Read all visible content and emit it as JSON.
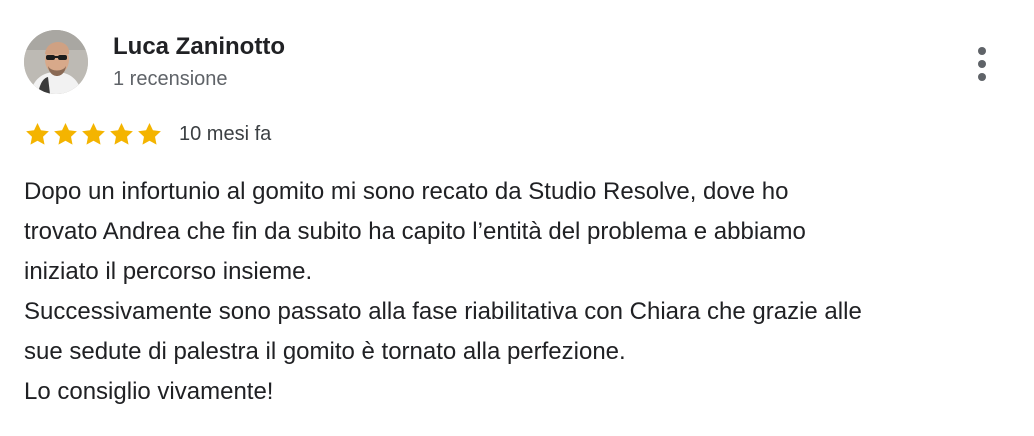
{
  "review": {
    "author": "Luca Zaninotto",
    "author_meta": "1 recensione",
    "rating": 5,
    "rating_max": 5,
    "date": "10 mesi fa",
    "text_lines": [
      "Dopo un infortunio al gomito mi sono recato da Studio Resolve, dove ho",
      "trovato Andrea che fin da subito ha capito l’entità del problema e abbiamo",
      "iniziato il percorso insieme.",
      "Successivamente sono passato alla fase riabilitativa con Chiara che grazie alle",
      "sue sedute di palestra il gomito è tornato alla perfezione.",
      "Lo consiglio vivamente!"
    ]
  },
  "icons": {
    "avatar": "user-photo-avatar",
    "more": "more-vertical-icon",
    "star": "star-filled-icon"
  },
  "colors": {
    "star": "#f4b400",
    "text": "#202124",
    "secondary_text": "#5f6368"
  }
}
